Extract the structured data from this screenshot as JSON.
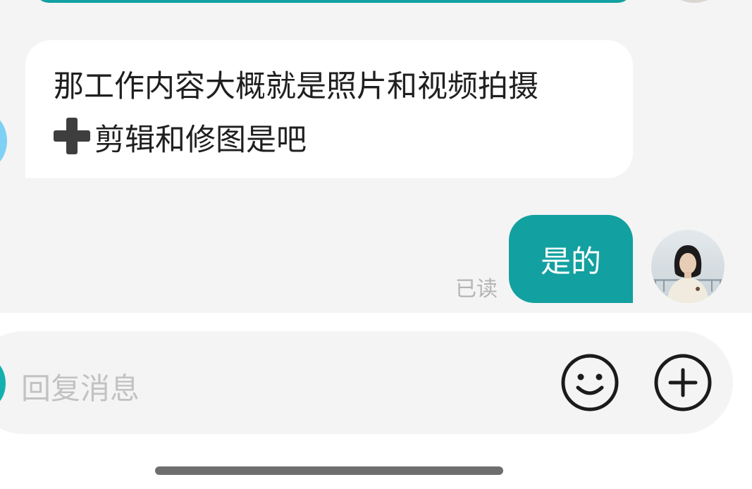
{
  "messages": [
    {
      "sender": "other",
      "lines": [
        "那工作内容大概就是照片和视频拍摄",
        "剪辑和修图是吧"
      ],
      "emoji": "heavy-plus-sign"
    },
    {
      "sender": "me",
      "text": "是的",
      "status": "已读"
    }
  ],
  "composer": {
    "placeholder": "回复消息",
    "emoji_icon": "smiley-icon",
    "add_icon": "plus-circle-icon"
  },
  "colors": {
    "accent": "#13a0a0",
    "chat_bg": "#f4f4f4",
    "incoming_bubble": "#ffffff",
    "read_text": "#b4b4b4"
  }
}
